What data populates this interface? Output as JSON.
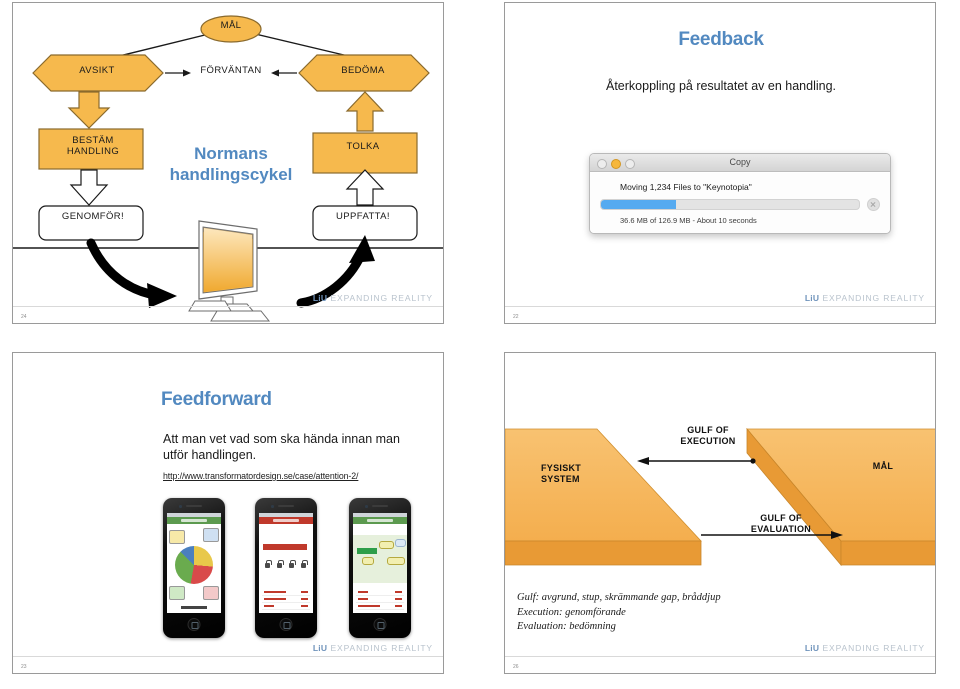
{
  "slides": {
    "normans": {
      "brand_line1": "Normans",
      "brand_line2": "handlingscykel",
      "nodes": {
        "mal": "MÅL",
        "avsikt": "AVSIKT",
        "forvantan": "FÖRVÄNTAN",
        "bedoma": "BEDÖMA",
        "bestam": "BESTÄM\nHANDLING",
        "bestam_line1": "BESTÄM",
        "bestam_line2": "HANDLING",
        "tolka": "TOLKA",
        "genomfor": "GENOMFÖR!",
        "uppfatta": "UPPFATTA!"
      },
      "logo_mark": "LiU",
      "logo_text": "EXPANDING REALITY",
      "slide_number": "24"
    },
    "feedback": {
      "title": "Feedback",
      "subtitle": "Återkoppling på resultatet av en handling.",
      "dialog": {
        "window_title": "Copy",
        "message": "Moving 1,234 Files to \"Keynotopia\"",
        "status": "36.6 MB of 126.9 MB - About 10 seconds",
        "progress_percent": 29,
        "accent_color": "#55aaf0"
      },
      "logo_mark": "LiU",
      "logo_text": "EXPANDING REALITY",
      "slide_number": "22"
    },
    "feedforward": {
      "title": "Feedforward",
      "body": "Att man vet vad som ska hända innan man utför handlingen.",
      "link": "http://www.transformatordesign.se/case/attention-2/",
      "logo_mark": "LiU",
      "logo_text": "EXPANDING REALITY",
      "slide_number": "23"
    },
    "gulf": {
      "gulf_execution_line1": "GULF OF",
      "gulf_execution_line2": "EXECUTION",
      "gulf_evaluation_line1": "GULF OF",
      "gulf_evaluation_line2": "EVALUATION",
      "physical_system_line1": "FYSISKT",
      "physical_system_line2": "SYSTEM",
      "goal": "MÅL",
      "legend_line1": "Gulf: avgrund, stup, skrämmande gap, bråddjup",
      "legend_line2": "Execution: genomförande",
      "legend_line3": "Evaluation: bedömning",
      "logo_mark": "LiU",
      "logo_text": "EXPANDING REALITY",
      "slide_number": "26"
    }
  },
  "colors": {
    "orange_fill": "#F6B94D",
    "orange_side": "#E09A38",
    "orange_border": "#8a6a2d",
    "title_blue": "#5289c0",
    "liu_blue": "#6f93bb",
    "slide_border": "#9a9a9a"
  }
}
